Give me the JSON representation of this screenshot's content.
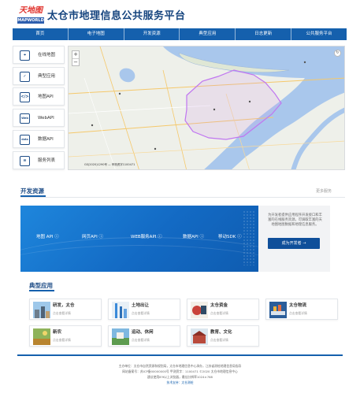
{
  "header": {
    "logo_cn": "天地图",
    "logo_en": "MAPWORLD",
    "site_title": "太仓市地理信息公共服务平台"
  },
  "nav": {
    "items": [
      "首页",
      "电子地图",
      "开发资源",
      "典型应用",
      "日志更新",
      "公共服务平台"
    ]
  },
  "sidebar": {
    "items": [
      {
        "label": "在线地图",
        "icon": "map-pin-icon",
        "glyph": "⌖"
      },
      {
        "label": "典型应用",
        "icon": "apps-icon",
        "glyph": "✓"
      },
      {
        "label": "地图API",
        "icon": "code-icon",
        "glyph": "</>"
      },
      {
        "label": "WebAPI",
        "icon": "web-icon",
        "glyph": "Web"
      },
      {
        "label": "数据API",
        "icon": "data-icon",
        "glyph": "data"
      },
      {
        "label": "服务列表",
        "icon": "list-icon",
        "glyph": "≡"
      }
    ]
  },
  "map": {
    "credit": "GS(2020)1290号 — 甲测资字1100471",
    "zoom_in": "+",
    "zoom_out": "−",
    "corner_glyph": "↻"
  },
  "dev": {
    "title": "开发资源",
    "more": "更多服务",
    "apis": [
      "地图 API ⓘ",
      "网页API ⓘ",
      "WEB服务API ⓘ",
      "数据API ⓘ",
      "移动SDK ⓘ"
    ],
    "panel_text": "为开发者提供应用程序开发接口和丰富的在线服务资源，可调取丰富的天地图地图数据和地理信息服务。",
    "become_btn": "成为开发者  →"
  },
  "apps": {
    "title": "典型应用",
    "items": [
      {
        "title": "研发，太仓",
        "sub": "点击查看详情"
      },
      {
        "title": "土地出让",
        "sub": "点击查看详情"
      },
      {
        "title": "太仓资金",
        "sub": "点击查看详情"
      },
      {
        "title": "太仓物流",
        "sub": "点击查看详情"
      },
      {
        "title": "新农",
        "sub": "点击查看详情"
      },
      {
        "title": "运动、休闲",
        "sub": "点击查看详情"
      },
      {
        "title": "教育、文化",
        "sub": "点击查看详情"
      }
    ]
  },
  "footer": {
    "line1": "主办单位：太仓市自然资源和规划局，太仓市地理信息中心承办，江苏省测绘地理信息局指导",
    "line2": "网站备案号：苏ICP备00000000号  甲测资字：1100471  ©2020 太仓市地理信息中心",
    "line3": "建议使用IE9以上浏览器，最佳分辨率1024×768",
    "line4": "技术支持：太仓测绘",
    "icp_link": "苏ICP备00000000号"
  },
  "colors": {
    "brand_blue": "#1560ad",
    "title_navy": "#16457f",
    "logo_red": "#e0312b"
  }
}
